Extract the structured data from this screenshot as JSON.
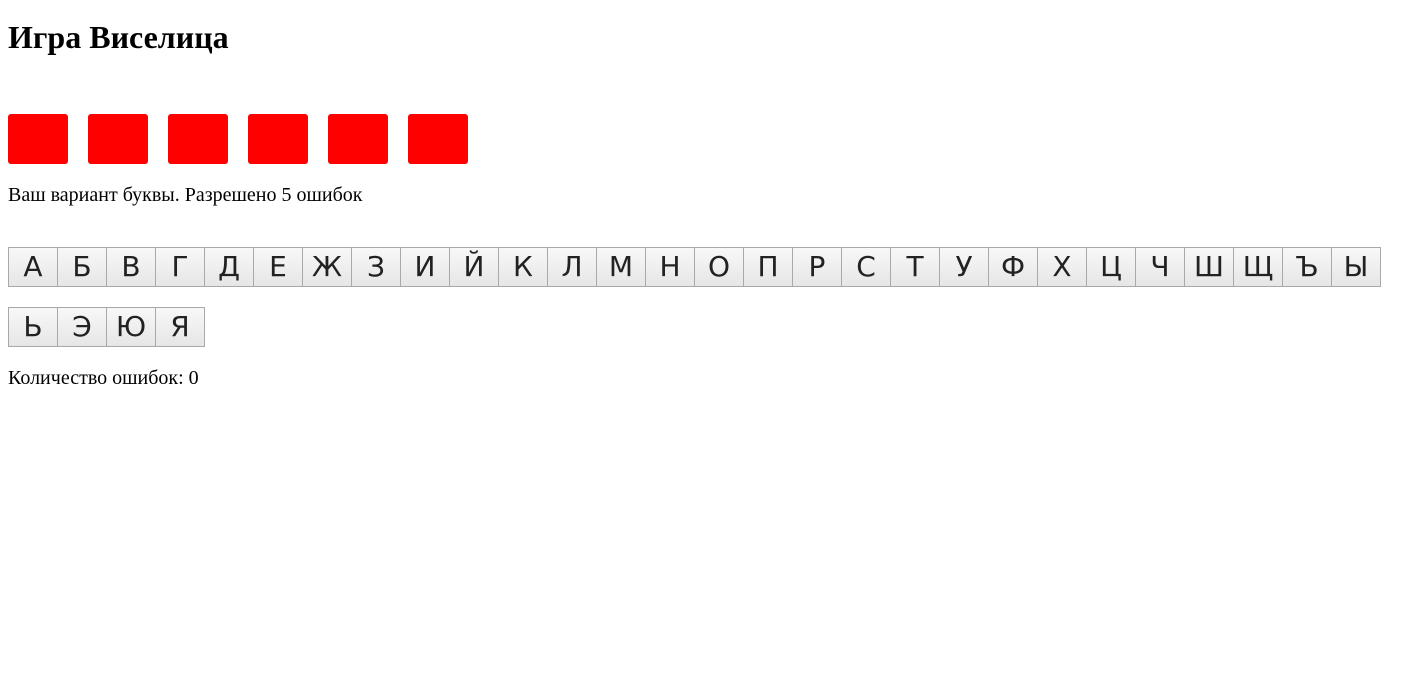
{
  "title": "Игра Виселица",
  "word": {
    "slot_count": 6,
    "slot_color": "#ff0000",
    "revealed": [
      "",
      "",
      "",
      "",
      "",
      ""
    ]
  },
  "instructions": "Ваш вариант буквы. Разрешено 5 ошибок",
  "keyboard": {
    "rows": [
      [
        "А",
        "Б",
        "В",
        "Г",
        "Д",
        "Е",
        "Ж",
        "З",
        "И",
        "Й",
        "К",
        "Л",
        "М",
        "Н",
        "О",
        "П",
        "Р",
        "С",
        "Т",
        "У",
        "Ф",
        "Х",
        "Ц",
        "Ч",
        "Ш",
        "Щ",
        "Ъ",
        "Ы"
      ],
      [
        "Ь",
        "Э",
        "Ю",
        "Я"
      ]
    ]
  },
  "status": {
    "errors_label": "Количество ошибок: 0",
    "errors": 0
  }
}
